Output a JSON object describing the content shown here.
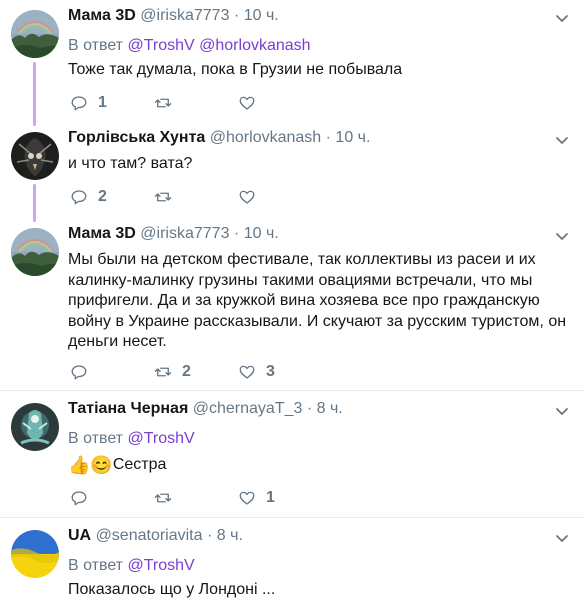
{
  "tweets": [
    {
      "name": "Мама 3D",
      "handle": "@iriska7773",
      "dot": "·",
      "time": "10 ч.",
      "reply_prefix": "В ответ",
      "reply_mentions": [
        "@TroshV",
        "@horlovkanash"
      ],
      "text": "Тоже так думала, пока в Грузии не побывала",
      "counts": {
        "reply": "1",
        "retweet": "",
        "like": ""
      }
    },
    {
      "name": "Горлівська Хунта",
      "handle": "@horlovkanash",
      "dot": "·",
      "time": "10 ч.",
      "text": "и что там? вата?",
      "counts": {
        "reply": "2",
        "retweet": "",
        "like": ""
      }
    },
    {
      "name": "Мама 3D",
      "handle": "@iriska7773",
      "dot": "·",
      "time": "10 ч.",
      "text": "Мы были на детском фестивале, так коллективы из расеи и их калинку-малинку  грузины такими овациями встречали,  что мы прифигели. Да и за кружкой вина хозяева все про гражданскую войну в Украине рассказывали. И  скучают за русским туристом, он деньги несет.",
      "counts": {
        "reply": "",
        "retweet": "2",
        "like": "3"
      }
    },
    {
      "name": "Татіана Черная",
      "handle": "@chernayaT_3",
      "dot": "·",
      "time": "8 ч.",
      "reply_prefix": "В ответ",
      "reply_mentions": [
        "@TroshV"
      ],
      "text": "Сестра",
      "emoji": [
        "👍",
        "😊"
      ],
      "counts": {
        "reply": "",
        "retweet": "",
        "like": "1"
      }
    },
    {
      "name": "UA",
      "handle": "@senatoriavita",
      "dot": "·",
      "time": "8 ч.",
      "reply_prefix": "В ответ",
      "reply_mentions": [
        "@TroshV"
      ],
      "text": "Показалось що у Лондоні ..."
    }
  ],
  "colors": {
    "thread_line": "#c9a7ec",
    "mention": "#7a3ed1",
    "secondary": "#657786",
    "divider": "#e6ecf0"
  },
  "icons": [
    "chevron-down-icon",
    "reply-icon",
    "retweet-icon",
    "like-icon"
  ]
}
